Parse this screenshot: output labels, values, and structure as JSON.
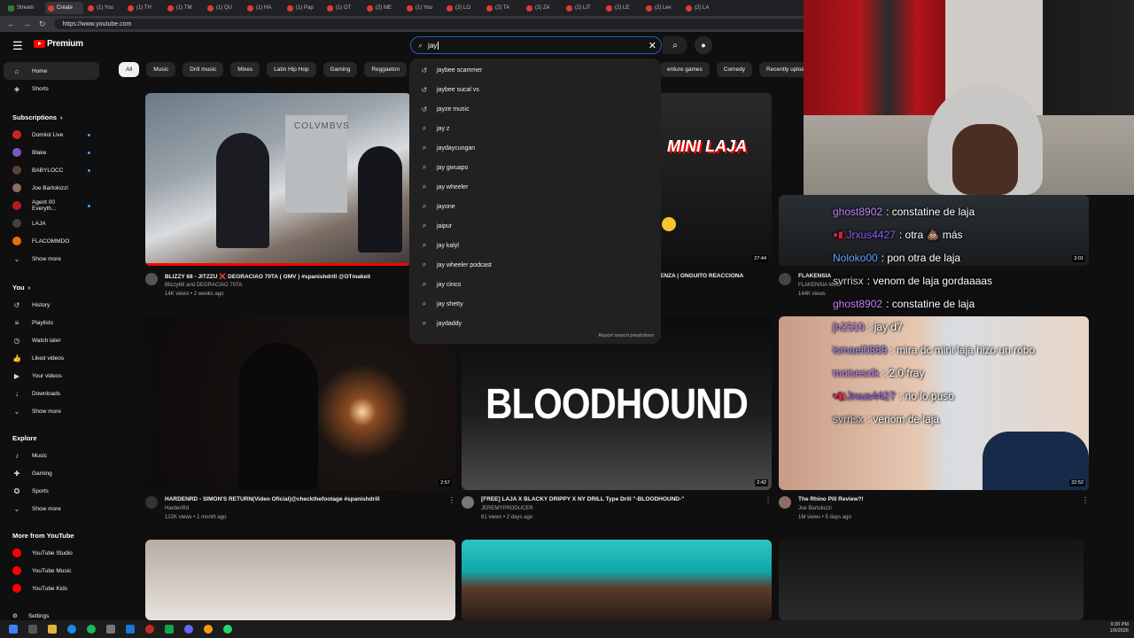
{
  "browser": {
    "tabs": [
      "Stream",
      "Create",
      "(1) You",
      "(1) TH",
      "(1) TM",
      "(1) QU",
      "(1) HA",
      "(1) Pap",
      "(1) OT",
      "(2) ME",
      "(1) You",
      "(2) LO",
      "(2) TA",
      "(2) ZA",
      "(2) LIT",
      "(2) LE",
      "(2) Lev",
      "(2) LA"
    ],
    "url": "https://www.youtube.com"
  },
  "header": {
    "logo": "Premium",
    "search_value": "jay"
  },
  "sidebar": {
    "main": [
      {
        "label": "Home",
        "icon": "home-icon"
      },
      {
        "label": "Shorts",
        "icon": "shorts-icon"
      }
    ],
    "subs_heading": "Subscriptions",
    "subs": [
      {
        "label": "Domilol Live",
        "color": "#c62828",
        "live": true
      },
      {
        "label": "Blake",
        "color": "#7e57c2",
        "live": true
      },
      {
        "label": "BABYLOCC",
        "color": "#5d4037",
        "live": true
      },
      {
        "label": "Joe Bartolozzi",
        "color": "#8d6e63",
        "live": false
      },
      {
        "label": "Agent 00 Everyth...",
        "color": "#b71c1c",
        "live": true
      },
      {
        "label": "LAJA",
        "color": "#424242",
        "live": false
      },
      {
        "label": "FLACOMMDO",
        "color": "#ef6c00",
        "live": false
      }
    ],
    "show_more": "Show more",
    "you_heading": "You",
    "you": [
      {
        "label": "History",
        "icon": "history-icon"
      },
      {
        "label": "Playlists",
        "icon": "playlists-icon"
      },
      {
        "label": "Watch later",
        "icon": "watch-later-icon"
      },
      {
        "label": "Liked videos",
        "icon": "liked-icon"
      },
      {
        "label": "Your videos",
        "icon": "your-videos-icon"
      },
      {
        "label": "Downloads",
        "icon": "download-icon"
      },
      {
        "label": "Show more",
        "icon": "chevron-down-icon"
      }
    ],
    "explore_heading": "Explore",
    "explore": [
      {
        "label": "Music",
        "icon": "music-icon"
      },
      {
        "label": "Gaming",
        "icon": "gaming-icon"
      },
      {
        "label": "Sports",
        "icon": "sports-icon"
      },
      {
        "label": "Show more",
        "icon": "chevron-down-icon"
      }
    ],
    "more_heading": "More from YouTube",
    "more": [
      {
        "label": "YouTube Studio"
      },
      {
        "label": "YouTube Music"
      },
      {
        "label": "YouTube Kids"
      }
    ],
    "settings": "Settings"
  },
  "chips_left": [
    "All",
    "Music",
    "Drill music",
    "Mixes",
    "Latin Hip Hop",
    "Gaming",
    "Reggaeton",
    "Pod"
  ],
  "chips_right": [
    "enture games",
    "Comedy",
    "Recently uploaded"
  ],
  "suggestions": [
    {
      "text": "jaybee scammer",
      "type": "history"
    },
    {
      "text": "jaybee sucal vs",
      "type": "history"
    },
    {
      "text": "jayze music",
      "type": "history"
    },
    {
      "text": "jay z",
      "type": "search"
    },
    {
      "text": "jaydaycungan",
      "type": "search"
    },
    {
      "text": "jay gwuapo",
      "type": "search"
    },
    {
      "text": "jay wheeler",
      "type": "search"
    },
    {
      "text": "jayone",
      "type": "search"
    },
    {
      "text": "jaipur",
      "type": "search"
    },
    {
      "text": "jay kalyl",
      "type": "search"
    },
    {
      "text": "jay wheeler podcast",
      "type": "search"
    },
    {
      "text": "jay cinco",
      "type": "search"
    },
    {
      "text": "jay shetty",
      "type": "search"
    },
    {
      "text": "jaydaddy",
      "type": "search"
    }
  ],
  "report_text": "Report search predictions",
  "videos": [
    {
      "title": "BLIZZY 68 - JITZZU ❌ DEGRACIAO 70TA ( OMV ) #spanishdrill @OTmakeit",
      "channel": "Blizzy68 and DEGRACIAO 70TA",
      "stats": "14K views • 2 weeks ago",
      "duration": ""
    },
    {
      "title": "ENZA | ONGUITO REACCIONA",
      "channel": "",
      "stats": "",
      "duration": "27:44"
    },
    {
      "title": "FLAKENSIA",
      "channel": "FLAKENSIA MOB",
      "stats": "144K views",
      "duration": "3:01"
    },
    {
      "title": "HARDENRD - SIMON'S RETURN(Video Oficial)@checkthefootage #spanishdrill",
      "channel": "HardenRd",
      "stats": "122K views • 1 month ago",
      "duration": "2:57"
    },
    {
      "title": "[FREE] LAJA X BLACKY DRIPPY X NY DRILL Type Drill \"-BLOODHOUND-\"",
      "channel": "JEREMYPRODUCER",
      "stats": "61 views • 2 days ago",
      "duration": "2:42"
    },
    {
      "title": "The Rhino Pill Review?!",
      "channel": "Joe Bartolozzi",
      "stats": "1M views • 5 days ago",
      "duration": "32:52"
    }
  ],
  "thumb_text": {
    "mini_laja": "MINI LAJA",
    "bloodhound": "BLOODHOUND",
    "colvmbvs": "COLVMBVS"
  },
  "chat": [
    {
      "user": "ghost8902",
      "msg": ": constatine de laja",
      "color": "#c084fc",
      "badge": false
    },
    {
      "user": "Jrxus4427",
      "msg": ": otra 💩 más",
      "color": "#8b5cf6",
      "badge": true
    },
    {
      "user": "Noloko00",
      "msg": ": pon otra de laja",
      "color": "#60a5fa",
      "badge": false
    },
    {
      "user": "svrrisx",
      "msg": ": venom de laja gordaaaas",
      "color": "#d1d5db",
      "badge": false
    },
    {
      "user": "ghost8902",
      "msg": ": constatine de laja",
      "color": "#c084fc",
      "badge": false
    },
    {
      "user": "jh2310",
      "msg": ": jay d7",
      "color": "#c084fc",
      "badge": false
    },
    {
      "user": "ismael0889",
      "msg": ": mira dc mini laja hizo un robo",
      "color": "#a78bfa",
      "badge": false
    },
    {
      "user": "moisesxlk",
      "msg": ": 2.0 fray",
      "color": "#c084fc",
      "badge": false
    },
    {
      "user": "Jrxus4427",
      "msg": ": no lo puso",
      "color": "#8b5cf6",
      "badge": true
    },
    {
      "user": "svrrisx",
      "msg": ": venom de laja",
      "color": "#d1d5db",
      "badge": false
    }
  ],
  "tray": {
    "time": "9:20 PM",
    "date": "1/9/2026"
  }
}
